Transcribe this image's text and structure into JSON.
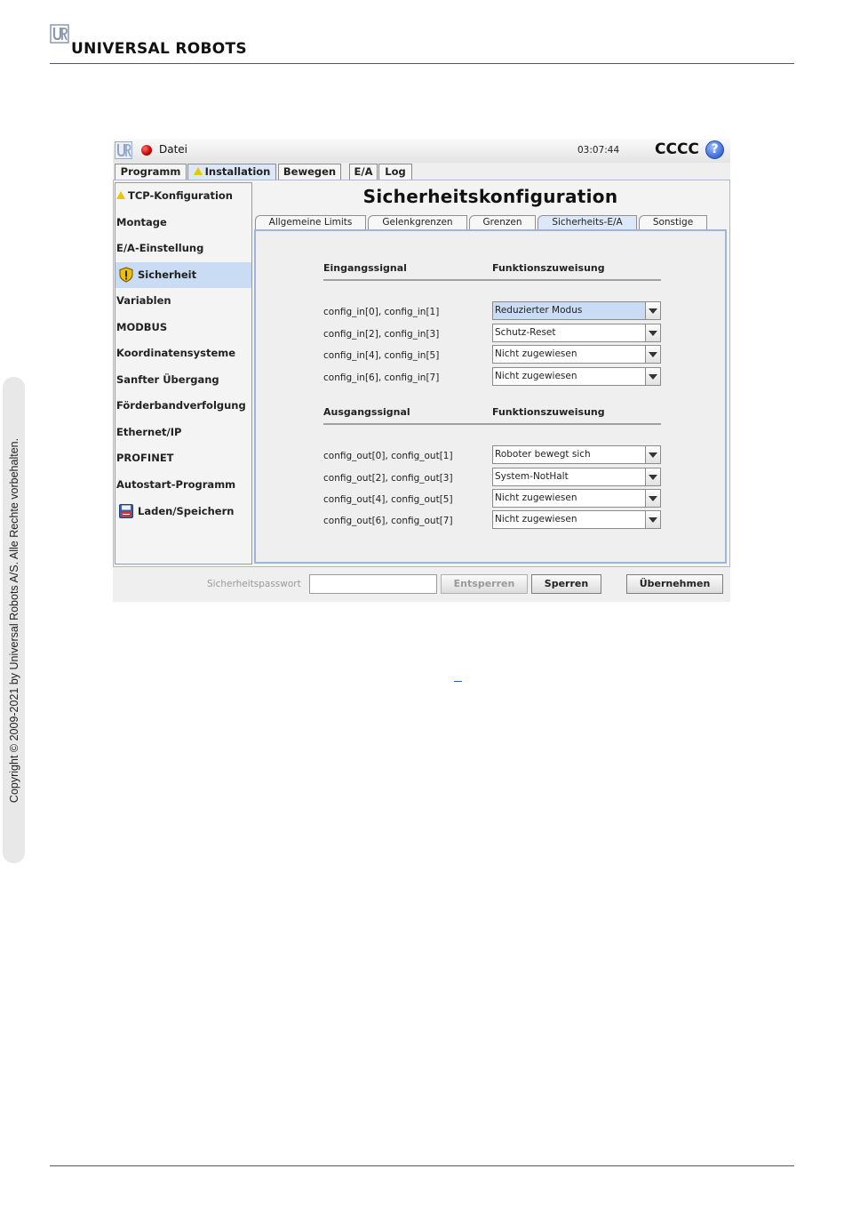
{
  "document": {
    "brand": "UNIVERSAL ROBOTS",
    "copyright": "Copyright © 2009-2021 by Universal Robots A/S. Alle Rechte vorbehalten."
  },
  "topbar": {
    "menu_file": "Datei",
    "clock": "03:07:44",
    "robot_name": "CCCC",
    "help": "?"
  },
  "main_tabs": [
    {
      "label": "Programm",
      "active": false
    },
    {
      "label": "Installation",
      "active": true,
      "warning": true
    },
    {
      "label": "Bewegen",
      "active": false
    },
    {
      "label": "E/A",
      "active": false
    },
    {
      "label": "Log",
      "active": false
    }
  ],
  "sidebar": {
    "items": [
      {
        "label": "TCP-Konfiguration",
        "icon": "warning-icon"
      },
      {
        "label": "Montage"
      },
      {
        "label": "E/A-Einstellung"
      },
      {
        "label": "Sicherheit",
        "icon": "shield-icon",
        "active": true
      },
      {
        "label": "Variablen"
      },
      {
        "label": "MODBUS"
      },
      {
        "label": "Koordinatensysteme"
      },
      {
        "label": "Sanfter Übergang"
      },
      {
        "label": "Förderbandverfolgung"
      },
      {
        "label": "Ethernet/IP"
      },
      {
        "label": "PROFINET"
      },
      {
        "label": "Autostart-Programm"
      },
      {
        "label": "Laden/Speichern",
        "icon": "save-icon"
      }
    ]
  },
  "content": {
    "title": "Sicherheitskonfiguration",
    "subtabs": [
      {
        "label": "Allgemeine Limits",
        "active": false
      },
      {
        "label": "Gelenkgrenzen",
        "active": false
      },
      {
        "label": "Grenzen",
        "active": false
      },
      {
        "label": "Sicherheits-E/A",
        "active": true
      },
      {
        "label": "Sonstige",
        "active": false
      }
    ],
    "inputs": {
      "header_signal": "Eingangssignal",
      "header_function": "Funktionszuweisung",
      "rows": [
        {
          "signal": "config_in[0], config_in[1]",
          "value": "Reduzierter Modus"
        },
        {
          "signal": "config_in[2], config_in[3]",
          "value": "Schutz-Reset"
        },
        {
          "signal": "config_in[4], config_in[5]",
          "value": "Nicht zugewiesen"
        },
        {
          "signal": "config_in[6], config_in[7]",
          "value": "Nicht zugewiesen"
        }
      ]
    },
    "outputs": {
      "header_signal": "Ausgangssignal",
      "header_function": "Funktionszuweisung",
      "rows": [
        {
          "signal": "config_out[0], config_out[1]",
          "value": "Roboter bewegt sich"
        },
        {
          "signal": "config_out[2], config_out[3]",
          "value": "System-NotHalt"
        },
        {
          "signal": "config_out[4], config_out[5]",
          "value": "Nicht zugewiesen"
        },
        {
          "signal": "config_out[6], config_out[7]",
          "value": "Nicht zugewiesen"
        }
      ]
    }
  },
  "bottombar": {
    "password_label": "Sicherheitspasswort",
    "password_value": "",
    "unlock_label": "Entsperren",
    "lock_label": "Sperren",
    "apply_label": "Übernehmen"
  },
  "colors": {
    "active_tab": "#dce8f7",
    "selection": "#c9dcf3",
    "frame_border": "#9fb4d6",
    "warning": "#e8c800",
    "status_led": "#c00000"
  }
}
